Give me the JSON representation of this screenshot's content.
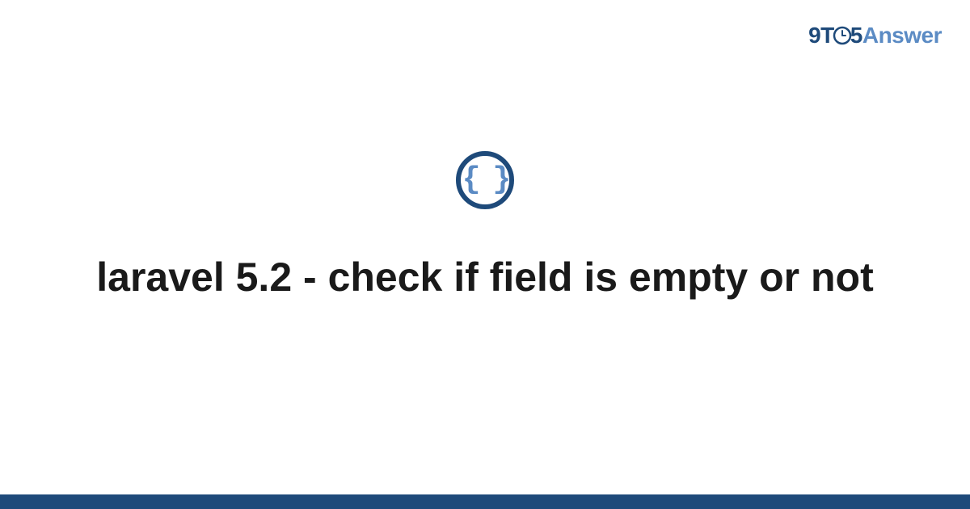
{
  "logo": {
    "prefix": "9T",
    "middle_digit": "5",
    "suffix": "Answer"
  },
  "icon": {
    "braces": "{ }",
    "semantic_name": "code-braces-icon"
  },
  "title": "laravel 5.2 - check if field is empty or not",
  "colors": {
    "primary": "#1e4a7a",
    "secondary": "#5b8bc4",
    "text": "#1a1a1a",
    "background": "#ffffff"
  }
}
